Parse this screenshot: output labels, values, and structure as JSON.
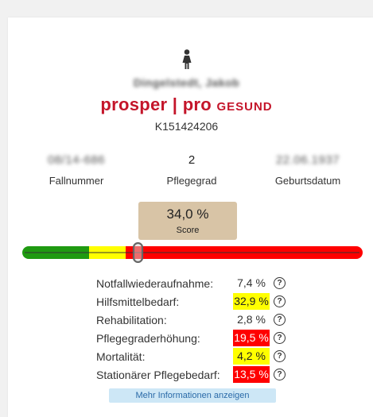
{
  "patient": {
    "name": "Dingelstedt, Jakob",
    "case_id": "K151424206"
  },
  "brand": {
    "part1": "prosper",
    "separator": "|",
    "part2": "pro",
    "part3": "GESUND",
    "color": "#c4152a"
  },
  "info": [
    {
      "value": "08/14-686",
      "label": "Fallnummer",
      "blurred": true
    },
    {
      "value": "2",
      "label": "Pflegegrad",
      "blurred": false
    },
    {
      "value": "22.06.1937",
      "label": "Geburtsdatum",
      "blurred": true
    }
  ],
  "score": {
    "value": "34,0 %",
    "label": "Score",
    "bar_level": 0.34,
    "colors": {
      "green": "#1f9a11",
      "yellow": "#ffff00",
      "red": "#ff0000"
    }
  },
  "metrics": [
    {
      "label": "Notfallwiederaufnahme:",
      "value": "7,4 %",
      "highlight": "none"
    },
    {
      "label": "Hilfsmittelbedarf:",
      "value": "32,9 %",
      "highlight": "yellow"
    },
    {
      "label": "Rehabilitation:",
      "value": "2,8 %",
      "highlight": "none"
    },
    {
      "label": "Pflegegraderhöhung:",
      "value": "19,5 %",
      "highlight": "red"
    },
    {
      "label": "Mortalität:",
      "value": "4,2 %",
      "highlight": "yellow"
    },
    {
      "label": "Stationärer Pflegebedarf:",
      "value": "13,5 %",
      "highlight": "red"
    }
  ],
  "help_icon": {
    "glyph": "?",
    "name": "help-circle-icon"
  },
  "more_button": {
    "label": "Mehr Informationen anzeigen"
  }
}
